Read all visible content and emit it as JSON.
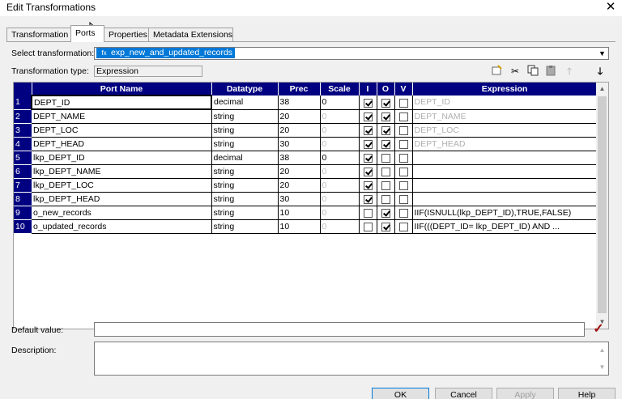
{
  "window": {
    "title": "Edit Transformations",
    "close_glyph": "✕"
  },
  "tabs": [
    {
      "label": "Transformation",
      "active": false
    },
    {
      "label": "Ports",
      "active": true
    },
    {
      "label": "Properties",
      "active": false
    },
    {
      "label": "Metadata Extensions",
      "active": false
    }
  ],
  "select_transformation": {
    "label": "Select transformation:",
    "value": "exp_new_and_updated_records",
    "icon": "expression-transformation-icon"
  },
  "transformation_type": {
    "label": "Transformation type:",
    "value": "Expression"
  },
  "toolbar": {
    "icons": [
      "new-port-icon",
      "cut-icon",
      "copy-icon",
      "paste-icon",
      "move-up-icon",
      "move-down-icon"
    ]
  },
  "grid": {
    "columns": [
      "Port Name",
      "Datatype",
      "Prec",
      "Scale",
      "I",
      "O",
      "V",
      "Expression"
    ],
    "rows": [
      {
        "num": "1",
        "name": "DEPT_ID",
        "datatype": "decimal",
        "prec": "38",
        "scale": "0",
        "scale_set": true,
        "i": true,
        "o": true,
        "v": false,
        "expr": "DEPT_ID",
        "expr_set": false,
        "selected": true
      },
      {
        "num": "2",
        "name": "DEPT_NAME",
        "datatype": "string",
        "prec": "20",
        "scale": "0",
        "scale_set": false,
        "i": true,
        "o": true,
        "v": false,
        "expr": "DEPT_NAME",
        "expr_set": false
      },
      {
        "num": "3",
        "name": "DEPT_LOC",
        "datatype": "string",
        "prec": "20",
        "scale": "0",
        "scale_set": false,
        "i": true,
        "o": true,
        "v": false,
        "expr": "DEPT_LOC",
        "expr_set": false
      },
      {
        "num": "4",
        "name": "DEPT_HEAD",
        "datatype": "string",
        "prec": "30",
        "scale": "0",
        "scale_set": false,
        "i": true,
        "o": true,
        "v": false,
        "expr": "DEPT_HEAD",
        "expr_set": false
      },
      {
        "num": "5",
        "name": "lkp_DEPT_ID",
        "datatype": "decimal",
        "prec": "38",
        "scale": "0",
        "scale_set": true,
        "i": true,
        "o": false,
        "v": false,
        "expr": "",
        "expr_set": false
      },
      {
        "num": "6",
        "name": "lkp_DEPT_NAME",
        "datatype": "string",
        "prec": "20",
        "scale": "0",
        "scale_set": false,
        "i": true,
        "o": false,
        "v": false,
        "expr": "",
        "expr_set": false
      },
      {
        "num": "7",
        "name": "lkp_DEPT_LOC",
        "datatype": "string",
        "prec": "20",
        "scale": "0",
        "scale_set": false,
        "i": true,
        "o": false,
        "v": false,
        "expr": "",
        "expr_set": false
      },
      {
        "num": "8",
        "name": "lkp_DEPT_HEAD",
        "datatype": "string",
        "prec": "30",
        "scale": "0",
        "scale_set": false,
        "i": true,
        "o": false,
        "v": false,
        "expr": "",
        "expr_set": false
      },
      {
        "num": "9",
        "name": "o_new_records",
        "datatype": "string",
        "prec": "10",
        "scale": "0",
        "scale_set": false,
        "i": false,
        "o": true,
        "v": false,
        "expr": "IIF(ISNULL(lkp_DEPT_ID),TRUE,FALSE)",
        "expr_set": true
      },
      {
        "num": "10",
        "name": "o_updated_records",
        "datatype": "string",
        "prec": "10",
        "scale": "0",
        "scale_set": false,
        "i": false,
        "o": true,
        "v": false,
        "expr": "IIF(((DEPT_ID= lkp_DEPT_ID) AND ...",
        "expr_set": true
      }
    ]
  },
  "default_value": {
    "label": "Default value:",
    "value": ""
  },
  "description": {
    "label": "Description:",
    "value": ""
  },
  "buttons": {
    "ok": "OK",
    "cancel": "Cancel",
    "apply": "Apply",
    "help": "Help"
  }
}
